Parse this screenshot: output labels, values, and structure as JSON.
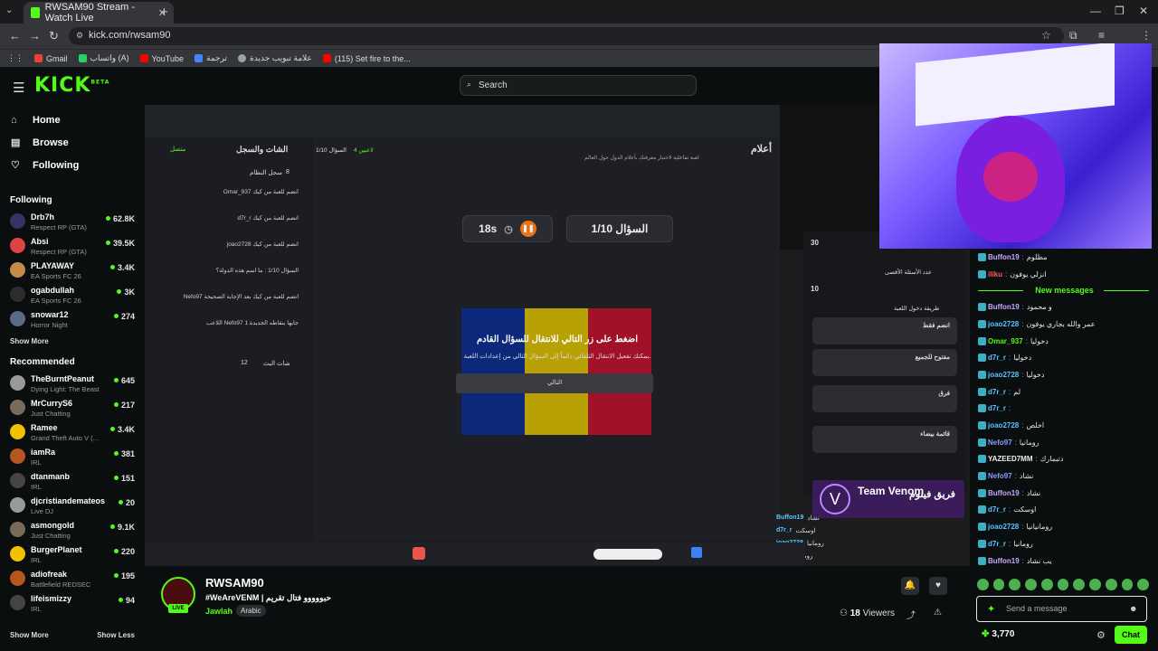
{
  "browser": {
    "tab_title": "RWSAM90 Stream - Watch Live",
    "url": "kick.com/rwsam90",
    "bookmarks": [
      "Gmail",
      "واتساب (A)",
      "YouTube",
      "ترجمة",
      "علامة تبويب جديدة",
      "(115) Set fire to the..."
    ]
  },
  "header": {
    "logo": "KICK",
    "logo_beta": "BETA",
    "search_placeholder": "Search"
  },
  "sidebar": {
    "nav": [
      {
        "label": "Home"
      },
      {
        "label": "Browse"
      },
      {
        "label": "Following"
      }
    ],
    "following_title": "Following",
    "following": [
      {
        "name": "Drb7h",
        "game": "Respect RP (GTA)",
        "viewers": "62.8K"
      },
      {
        "name": "Absi",
        "game": "Respect RP (GTA)",
        "viewers": "39.5K"
      },
      {
        "name": "PLAYAWAY",
        "game": "EA Sports FC 26",
        "viewers": "3.4K"
      },
      {
        "name": "ogabdullah",
        "game": "EA Sports FC 26",
        "viewers": "3K"
      },
      {
        "name": "snowar12",
        "game": "Horror Night",
        "viewers": "274"
      }
    ],
    "show_more": "Show More",
    "recommended_title": "Recommended",
    "recommended": [
      {
        "name": "TheBurntPeanut",
        "game": "Dying Light: The Beast",
        "viewers": "645"
      },
      {
        "name": "MrCurryS6",
        "game": "Just Chatting",
        "viewers": "217"
      },
      {
        "name": "Ramee",
        "game": "Grand Theft Auto V (...",
        "viewers": "3.4K"
      },
      {
        "name": "iamRa",
        "game": "IRL",
        "viewers": "381"
      },
      {
        "name": "dtanmanb",
        "game": "IRL",
        "viewers": "151"
      },
      {
        "name": "djcristiandemateos",
        "game": "Live DJ",
        "viewers": "20"
      },
      {
        "name": "asmongold",
        "game": "Just Chatting",
        "viewers": "9.1K"
      },
      {
        "name": "BurgerPlanet",
        "game": "IRL",
        "viewers": "220"
      },
      {
        "name": "adiofreak",
        "game": "Battlefield REDSEC",
        "viewers": "195"
      },
      {
        "name": "lifeismizzy",
        "game": "IRL",
        "viewers": "94"
      }
    ],
    "show_more_bottom": "Show More",
    "show_less": "Show Less"
  },
  "stream_overlay": {
    "chat_log_title": "الشات والسجل",
    "connected": "متصل",
    "system_log": "سجل النظام",
    "system_count": "8",
    "log_lines": [
      "Omar_937 انضم للعبة من كيك",
      "d7r_r انضم للعبة من كيك",
      "joao2728 انضم للعبة من كيك",
      "السؤال 1/10 : ما اسم هذه الدولة؟",
      "Nefo97 انضم للعبة من كيك بعد الإجابة الصحيحة",
      "اللاعب Nefo97 جابها بنقاطه الجديدة 1"
    ],
    "live_chat": "شات البث",
    "live_count": "12",
    "game_title": "أعلام",
    "game_subtitle": "لعبة تفاعلية لاختبار معرفتك بأعلام الدول حول العالم",
    "players": "4 لاعبين",
    "question_counter": "السؤال 1/10",
    "timer": "18s",
    "question_label": "السؤال 1/10",
    "modal_title": "اضغط على زر التالي للانتقال للسؤال القادم",
    "modal_sub": "يمكنك تفعيل الانتقال التلقائي دائماً إلى السؤال التالي من إعدادات اللعبة.",
    "modal_button": "التالي",
    "setting_30": "30",
    "setting_10": "10",
    "max_questions": "عدد الأسئلة الأقصى",
    "join_method": "طريقة دخول اللعبة",
    "opt_1": "انضم فقط",
    "opt_2": "مفتوح للجميع",
    "opt_3": "فرق",
    "opt_4": "قائمة بيضاء",
    "team_venom_en": "Team Venom",
    "team_venom_ar": "فريق فينوم",
    "overlay_msgs": [
      {
        "user": "Buffon19",
        "text": "نشاد"
      },
      {
        "user": "d7r_r",
        "text": "اوسكت"
      },
      {
        "user": "joao2728",
        "text": "رومانيا"
      },
      {
        "user": "d7r_r",
        "text": "رومانيا"
      }
    ]
  },
  "chat": {
    "pre_messages": [
      {
        "user": "Buffon19",
        "text": "مظلوم",
        "color": "#c7a6ff"
      },
      {
        "user": "iliku",
        "text": "انزلي يوفون",
        "color": "#ff5b5b"
      }
    ],
    "new_messages_label": "New messages",
    "messages": [
      {
        "user": "Buffon19",
        "text": "و محمود",
        "color": "#c7a6ff"
      },
      {
        "user": "joao2728",
        "text": "عمر والله بجاري يوفون",
        "color": "#56c7ff"
      },
      {
        "user": "Omar_937",
        "text": "دخوليا",
        "color": "#53fc18"
      },
      {
        "user": "d7r_r",
        "text": "دخوليا",
        "color": "#56c7ff"
      },
      {
        "user": "joao2728",
        "text": "دخوليا",
        "color": "#56c7ff"
      },
      {
        "user": "d7r_r",
        "text": "لم",
        "color": "#56c7ff"
      },
      {
        "user": "d7r_r",
        "text": "",
        "color": "#56c7ff"
      },
      {
        "user": "joao2728",
        "text": "اخلص",
        "color": "#56c7ff"
      },
      {
        "user": "Nefo97",
        "text": "رومانيا",
        "color": "#8a9cff"
      },
      {
        "user": "YAZEED7MM",
        "text": "دتبمارك",
        "color": "#eeeeee"
      },
      {
        "user": "Nefo97",
        "text": "نشاد",
        "color": "#8a9cff"
      },
      {
        "user": "Buffon19",
        "text": "نشاد",
        "color": "#c7a6ff"
      },
      {
        "user": "d7r_r",
        "text": "اوسكت",
        "color": "#56c7ff"
      },
      {
        "user": "joao2728",
        "text": "رومانيانيا",
        "color": "#56c7ff"
      },
      {
        "user": "d7r_r",
        "text": "رومانيا",
        "color": "#56c7ff"
      },
      {
        "user": "Buffon19",
        "text": "يب نشاد",
        "color": "#c7a6ff"
      }
    ],
    "input_placeholder": "Send a message",
    "points": "3,770",
    "send_label": "Chat"
  },
  "streamer": {
    "name": "RWSAM90",
    "live": "LIVE",
    "title": "#WeAreVENM | حبووووو فتال تقريم",
    "category": "Jawlah",
    "tag": "Arabic",
    "viewers": "18",
    "viewers_label": "Viewers"
  }
}
